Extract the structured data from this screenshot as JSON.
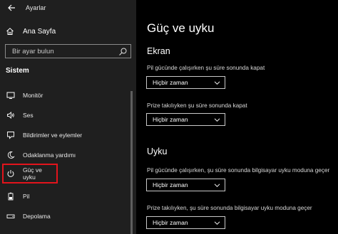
{
  "app": {
    "title": "Ayarlar"
  },
  "sidebar": {
    "home_label": "Ana Sayfa",
    "search_placeholder": "Bir ayar bulun",
    "section_title": "Sistem",
    "items": [
      {
        "label": "Monitör",
        "icon": "monitor-icon"
      },
      {
        "label": "Ses",
        "icon": "speaker-icon"
      },
      {
        "label": "Bildirimler ve eylemler",
        "icon": "notification-icon"
      },
      {
        "label": "Odaklanma yardımı",
        "icon": "moon-icon"
      },
      {
        "label": "Güç ve uyku",
        "icon": "power-icon",
        "selected": true
      },
      {
        "label": "Pil",
        "icon": "battery-icon"
      },
      {
        "label": "Depolama",
        "icon": "storage-icon"
      }
    ]
  },
  "main": {
    "title": "Güç ve uyku",
    "screen": {
      "heading": "Ekran",
      "battery_label": "Pil gücünde çalışırken şu süre sonunda kapat",
      "battery_value": "Hiçbir zaman",
      "plugged_label": "Prize takılıyken şu süre sonunda kapat",
      "plugged_value": "Hiçbir zaman"
    },
    "sleep": {
      "heading": "Uyku",
      "battery_label": "Pil gücünde çalışırken, şu süre sonunda bilgisayar uyku moduna geçer",
      "battery_value": "Hiçbir zaman",
      "plugged_label": "Prize takılıyken, şu süre sonunda bilgisayar uyku moduna geçer",
      "plugged_value": "Hiçbir zaman"
    }
  },
  "colors": {
    "highlight_border": "#e3141c",
    "sidebar_bg": "#1f1f1f",
    "main_bg": "#000000"
  }
}
